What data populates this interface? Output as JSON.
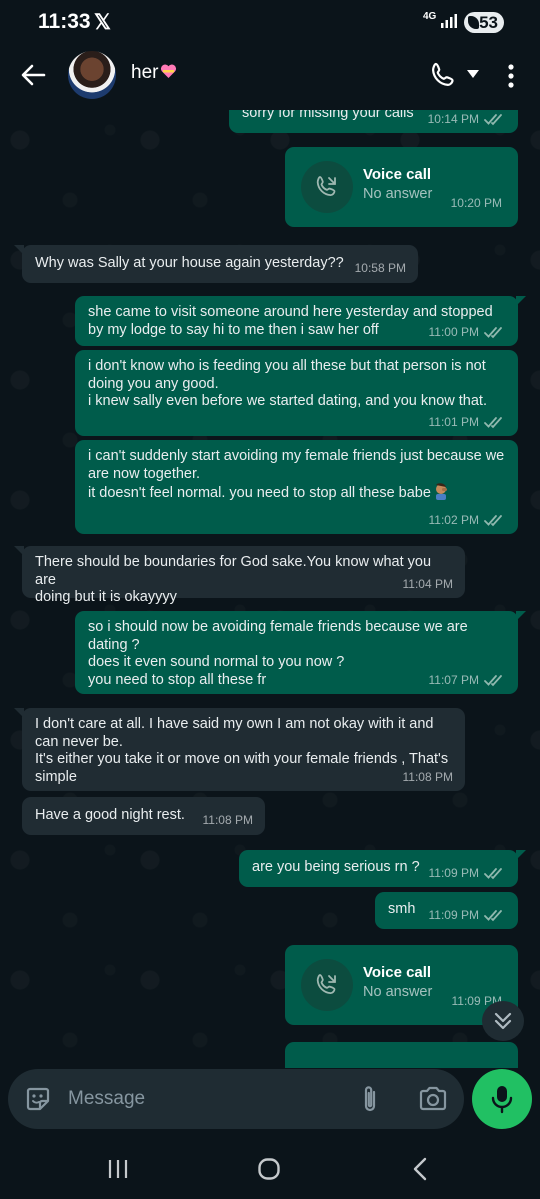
{
  "status_bar": {
    "time": "11:33",
    "x_logo": "𝕏",
    "network": "4G",
    "battery": "53"
  },
  "header": {
    "contact_name": "her",
    "icons": [
      "back-arrow-icon",
      "voice-call-icon",
      "dropdown-arrow-icon",
      "more-vert-icon"
    ]
  },
  "messages": [
    {
      "dir": "out",
      "text": "sorry for missing your calls",
      "time": "10:14 PM",
      "read": true
    },
    {
      "type": "voice_call",
      "title": "Voice call",
      "subtitle": "No answer",
      "time": "10:20 PM"
    },
    {
      "dir": "in",
      "text": "Why was Sally at your house again yesterday??",
      "time": "10:58 PM"
    },
    {
      "dir": "out",
      "text": "she came to visit someone around here yesterday and stopped\nby my lodge to say hi to me then i saw her off",
      "time": "11:00 PM",
      "read": true
    },
    {
      "dir": "out",
      "text": "i don't know who is feeding you all these but that person is not\ndoing you any good.\ni knew sally even before we started dating, and you know that.",
      "time": "11:01 PM",
      "read": true
    },
    {
      "dir": "out",
      "text": "i can't suddenly start avoiding my female friends just because we\nare now together.\nit doesn't feel normal. you need to stop all these babe",
      "time": "11:02 PM",
      "read": true,
      "emoji": "facepalm-emoji"
    },
    {
      "dir": "in",
      "text": "There should be boundaries for God sake.You know what you are\ndoing but it is okayyyy",
      "time": "11:04 PM"
    },
    {
      "dir": "out",
      "text": "so i should now be avoiding female friends because we are\ndating ?\ndoes it even sound normal to you now ?\nyou need to stop all these fr",
      "time": "11:07 PM",
      "read": true
    },
    {
      "dir": "in",
      "text": "I don't care at all.  I have said my own  I am not okay with it and\ncan never be.\nIt's either you take it or move on with your female friends , That's\nsimple",
      "time": "11:08 PM"
    },
    {
      "dir": "in",
      "text": "Have a good night rest.",
      "time": "11:08 PM"
    },
    {
      "dir": "out",
      "text": "are you being serious rn ?",
      "time": "11:09 PM",
      "read": true
    },
    {
      "dir": "out",
      "text": "smh",
      "time": "11:09 PM",
      "read": true
    },
    {
      "type": "voice_call",
      "title": "Voice call",
      "subtitle": "No answer",
      "time": "11:09 PM"
    }
  ],
  "composer": {
    "placeholder": "Message",
    "icons": [
      "emoji-sticker-icon",
      "attach-icon",
      "camera-icon",
      "mic-icon"
    ]
  },
  "colors": {
    "background": "#0b141a",
    "outgoing_bubble": "#005c4b",
    "incoming_bubble": "#202c33",
    "accent": "#21c063",
    "read_ticks": "#8fb8ae"
  }
}
